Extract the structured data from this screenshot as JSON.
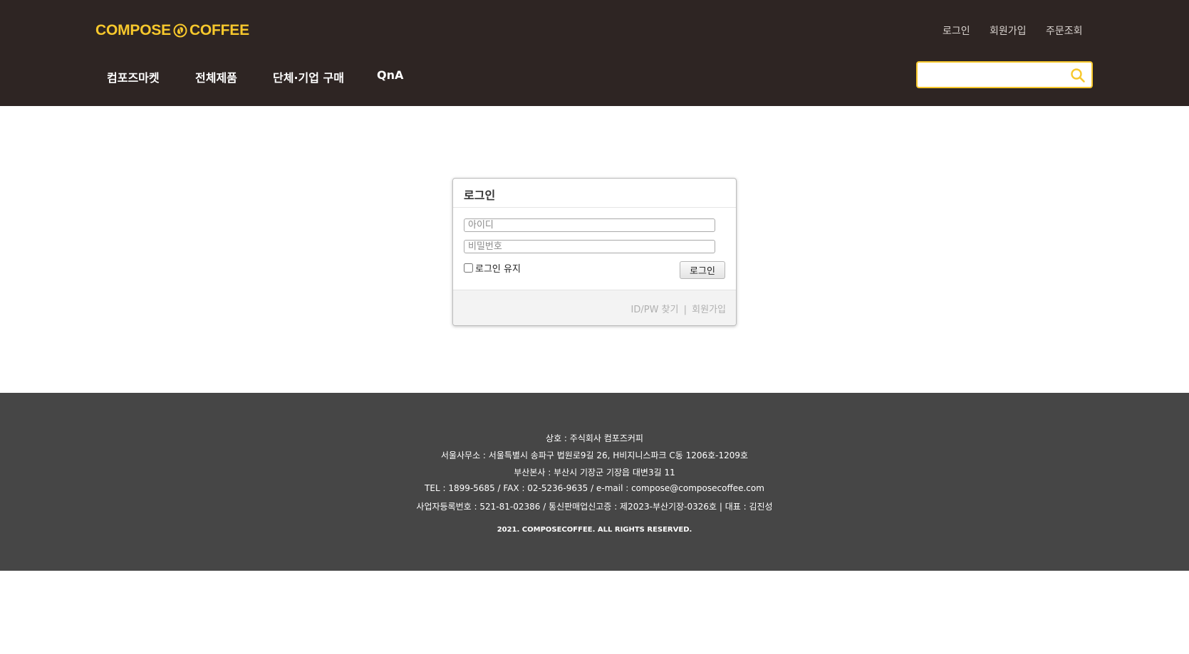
{
  "header": {
    "logo_left": "COMPOSE",
    "logo_right": "COFFEE",
    "util_links": [
      "로그인",
      "회원가입",
      "주문조회"
    ],
    "nav": [
      "컴포즈마켓",
      "전체제품",
      "단체·기업 구매",
      "QnA"
    ],
    "search": {
      "value": "",
      "placeholder": ""
    },
    "colors": {
      "background": "#2e2523",
      "accent": "#f7c82c"
    }
  },
  "login": {
    "title": "로그인",
    "id_placeholder": "아이디",
    "pw_placeholder": "비밀번호",
    "keep_label": "로그인 유지",
    "keep_checked": false,
    "button_label": "로그인",
    "find_link": "ID/PW 찾기",
    "divider": "|",
    "join_link": "회원가입"
  },
  "footer": {
    "lines": [
      "상호 : 주식회사 컴포즈커피",
      "서울사무소 : 서울특별시 송파구 법원로9길 26, H비지니스파크 C동 1206호-1209호",
      "부산본사 : 부산시 기장군 기장읍 대변3길 11",
      "TEL : 1899-5685 / FAX : 02-5236-9635 / e-mail : compose@composecoffee.com",
      "사업자등록번호 : 521-81-02386 / 통신판매업신고증 : 제2023-부산기장-0326호 | 대표 : 김진성"
    ],
    "copyright": "2021. COMPOSECOFFEE. ALL RIGHTS RESERVED.",
    "background": "#464646"
  }
}
